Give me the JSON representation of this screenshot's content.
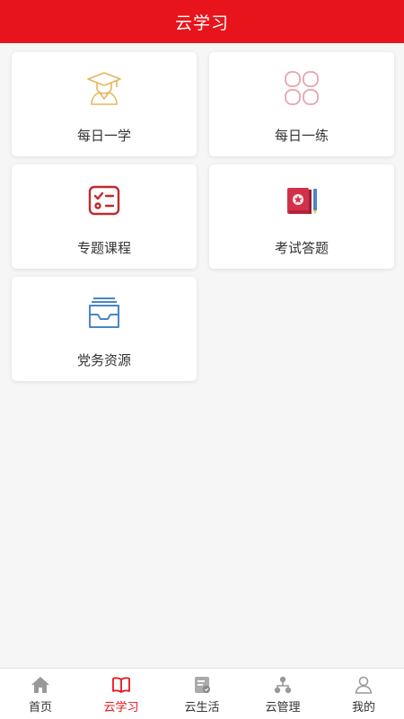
{
  "header": {
    "title": "云学习"
  },
  "cards": [
    {
      "label": "每日一学",
      "icon": "graduate-icon"
    },
    {
      "label": "每日一练",
      "icon": "clover-icon"
    },
    {
      "label": "专题课程",
      "icon": "checklist-icon"
    },
    {
      "label": "考试答题",
      "icon": "exam-book-icon"
    },
    {
      "label": "党务资源",
      "icon": "inbox-tray-icon"
    }
  ],
  "tabbar": {
    "items": [
      {
        "label": "首页",
        "icon": "home-icon",
        "active": false
      },
      {
        "label": "云学习",
        "icon": "book-icon",
        "active": true
      },
      {
        "label": "云生活",
        "icon": "life-icon",
        "active": false
      },
      {
        "label": "云管理",
        "icon": "org-chart-icon",
        "active": false
      },
      {
        "label": "我的",
        "icon": "user-icon",
        "active": false
      }
    ]
  },
  "colors": {
    "accent": "#e8141b",
    "gold": "#e3b75c",
    "pink": "#e8a3ad",
    "darkred": "#c22a2a",
    "blue": "#4a86c5"
  }
}
